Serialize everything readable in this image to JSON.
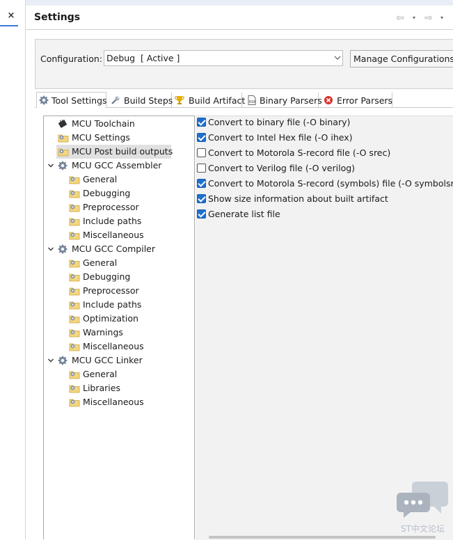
{
  "left_editor": {
    "close_glyph": "×"
  },
  "header": {
    "title": "Settings",
    "nav": {
      "back_icon": "arrow-left-icon",
      "forward_icon": "arrow-right-icon",
      "dropdown_glyph": "▾",
      "back_glyph": "⇦",
      "forward_glyph": "⇨"
    }
  },
  "configuration": {
    "label": "Configuration:",
    "value": "Debug  [ Active ]",
    "manage_label": "Manage Configurations..."
  },
  "tabs": [
    {
      "label": "Tool Settings",
      "icon": "gear-icon",
      "active": true
    },
    {
      "label": "Build Steps",
      "icon": "wrench-icon"
    },
    {
      "label": "Build Artifact",
      "icon": "trophy-icon"
    },
    {
      "label": "Binary Parsers",
      "icon": "binary-file-icon"
    },
    {
      "label": "Error Parsers",
      "icon": "error-icon"
    }
  ],
  "tree": [
    {
      "label": "MCU Toolchain",
      "icon": "chip-icon",
      "level": 0
    },
    {
      "label": "MCU Settings",
      "icon": "settings-folder-icon",
      "level": 0
    },
    {
      "label": "MCU Post build outputs",
      "icon": "settings-folder-icon",
      "level": 0,
      "selected": true
    },
    {
      "label": "MCU GCC Assembler",
      "icon": "gear-icon",
      "level": 0,
      "expanded": true
    },
    {
      "label": "General",
      "icon": "settings-folder-icon",
      "level": 1
    },
    {
      "label": "Debugging",
      "icon": "settings-folder-icon",
      "level": 1
    },
    {
      "label": "Preprocessor",
      "icon": "settings-folder-icon",
      "level": 1
    },
    {
      "label": "Include paths",
      "icon": "settings-folder-icon",
      "level": 1
    },
    {
      "label": "Miscellaneous",
      "icon": "settings-folder-icon",
      "level": 1
    },
    {
      "label": "MCU GCC Compiler",
      "icon": "gear-icon",
      "level": 0,
      "expanded": true
    },
    {
      "label": "General",
      "icon": "settings-folder-icon",
      "level": 1
    },
    {
      "label": "Debugging",
      "icon": "settings-folder-icon",
      "level": 1
    },
    {
      "label": "Preprocessor",
      "icon": "settings-folder-icon",
      "level": 1
    },
    {
      "label": "Include paths",
      "icon": "settings-folder-icon",
      "level": 1
    },
    {
      "label": "Optimization",
      "icon": "settings-folder-icon",
      "level": 1
    },
    {
      "label": "Warnings",
      "icon": "settings-folder-icon",
      "level": 1
    },
    {
      "label": "Miscellaneous",
      "icon": "settings-folder-icon",
      "level": 1
    },
    {
      "label": "MCU GCC Linker",
      "icon": "gear-icon",
      "level": 0,
      "expanded": true
    },
    {
      "label": "General",
      "icon": "settings-folder-icon",
      "level": 1
    },
    {
      "label": "Libraries",
      "icon": "settings-folder-icon",
      "level": 1
    },
    {
      "label": "Miscellaneous",
      "icon": "settings-folder-icon",
      "level": 1
    }
  ],
  "options": [
    {
      "label": "Convert to binary file (-O binary)",
      "checked": true
    },
    {
      "label": "Convert to Intel Hex file (-O ihex)",
      "checked": true
    },
    {
      "label": "Convert to Motorola S-record file (-O srec)",
      "checked": false
    },
    {
      "label": "Convert to Verilog file (-O verilog)",
      "checked": false
    },
    {
      "label": "Convert to Motorola S-record (symbols) file (-O symbolsrec)",
      "checked": true
    },
    {
      "label": "Show size information about built artifact",
      "checked": true
    },
    {
      "label": "Generate list file",
      "checked": true
    }
  ],
  "watermark": {
    "text": "ST中文论坛",
    "icon": "chat-bubbles-icon"
  },
  "colors": {
    "checkbox": "#1f6fd0",
    "selection": "#e0e0e0",
    "options_bg": "#f2f2f2",
    "watermark": "#b8bfc8"
  }
}
